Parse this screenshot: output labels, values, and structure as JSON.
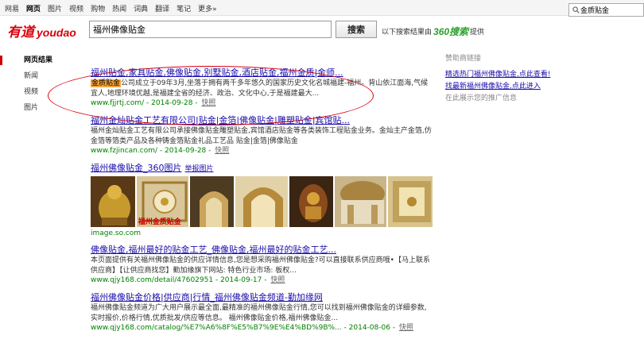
{
  "topnav": {
    "items": [
      "网易",
      "网页",
      "图片",
      "视频",
      "购物",
      "热闻",
      "词典",
      "翻译",
      "笔记",
      "更多»"
    ],
    "active_index": 1
  },
  "top_search": {
    "value": "金质贴金"
  },
  "logo": {
    "cn": "有道",
    "en": "youdao"
  },
  "search": {
    "value": "福州佛像贴金",
    "button": "搜索"
  },
  "provided_by": {
    "prefix": "以下搜索结果由",
    "brand": "360搜索",
    "suffix": "提供"
  },
  "leftnav": {
    "items": [
      "网页结果",
      "新闻",
      "视频",
      "图片"
    ],
    "active_index": 0
  },
  "results": [
    {
      "title": "福州贴金,家具贴金,佛像贴金,别墅贴金,酒店贴金,福州金质|金师...",
      "desc_box": "金质贴金",
      "desc": "公司成立于09年3月,坐落于拥有两千多年悠久的国家历史文化名城福建-福州。背山依江面海,气候宜人,地理环境优越,是福建全省的经济、政治、文化中心,于是福建最大...",
      "url": "www.fjjrtj.com/",
      "date": "2014-09-28",
      "snapshot": "快照"
    },
    {
      "title": "福州金灿贴金工艺有限公司|贴金|金箔|佛像贴金|雕塑贴金|宾馆贴...",
      "desc": "福州金灿贴金工艺有限公司承接佛像贴金雕塑贴金,宾馆酒店贴金等各类装饰工程贴金业务。金灿主产金箔,仿金箔等箔类产品及各种铸金箔贴金礼品工艺品 贴金|金箔|佛像贴金",
      "url": "www.fzjincan.com/",
      "date": "2014-09-28",
      "snapshot": "快照"
    },
    {
      "title": "福州佛像贴金_360图片",
      "report": "举报图片",
      "source": "image.so.com",
      "thumb_caption": "福州金质贴金"
    },
    {
      "title": "佛像贴金,福州最好的贴金工艺_佛像贴金,福州最好的贴金工艺...",
      "desc": "本页面提供有关福州佛像贴金的供应详情信息,您是想采购福州佛像贴金?可以直接联系供应商哦•【马上联系供应商】【让供应商找您】勤加缘旗下网站: 特色行业市场: 板权...",
      "url": "www.qjy168.com/detail/47602951",
      "date": "2014-09-17",
      "snapshot": "快照"
    },
    {
      "title": "福州佛像贴金价格|供应商|行情_福州佛像贴金频道-勤加缘网",
      "desc": "福州佛像贴金频道为广大用户展示最全面,最精准的福州佛像贴金行情,您可以找到福州佛像贴金的详细参数,实时报价,价格行情,优质批发/供应等信息。 福州佛像贴金价格,福州佛像贴金...",
      "url": "www.qjy168.com/catalog/%E7%A6%8F%E5%B7%9E%E4%BD%9B%...",
      "date": "2014-08-06",
      "snapshot": "快照"
    }
  ],
  "sidebar": {
    "head": "赞助商链接",
    "links": [
      {
        "text": "精选热门福州佛像贴金,点此查看!"
      },
      {
        "text": "找最新福州佛像贴金,点此进入"
      }
    ],
    "more": "在此展示您的推广信息"
  },
  "colors": {
    "brand_red": "#d8000c",
    "link": "#1a0dab",
    "url_green": "#008000",
    "highlight": "#cc0000",
    "brand_360": "#2aa12a"
  }
}
